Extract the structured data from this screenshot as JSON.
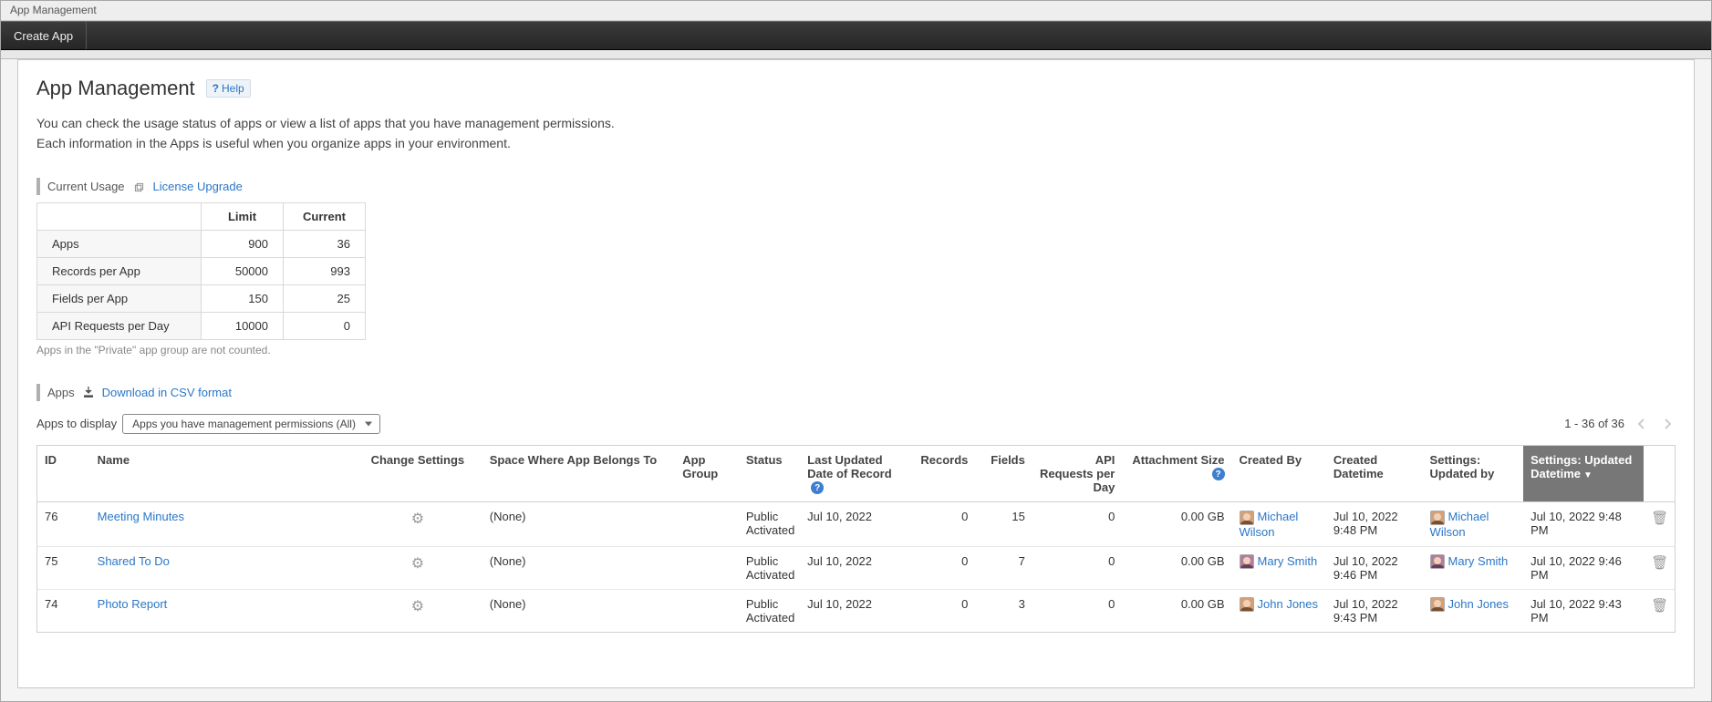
{
  "titlebar": "App Management",
  "toolbar": {
    "create_label": "Create App"
  },
  "heading": "App Management",
  "help_label": "Help",
  "description_l1": "You can check the usage status of apps or view a list of apps that you have management permissions.",
  "description_l2": "Each information in the Apps is useful when you organize apps in your environment.",
  "section_usage": {
    "title": "Current Usage",
    "upgrade_label": "License Upgrade"
  },
  "usage_table": {
    "col_limit": "Limit",
    "col_current": "Current",
    "rows": [
      {
        "label": "Apps",
        "limit": "900",
        "current": "36"
      },
      {
        "label": "Records per App",
        "limit": "50000",
        "current": "993"
      },
      {
        "label": "Fields per App",
        "limit": "150",
        "current": "25"
      },
      {
        "label": "API Requests per Day",
        "limit": "10000",
        "current": "0"
      }
    ],
    "footnote": "Apps in the \"Private\" app group are not counted."
  },
  "section_apps": {
    "title": "Apps",
    "download_label": "Download in CSV format"
  },
  "filter": {
    "label": "Apps to display",
    "selected": "Apps you have management permissions (All)"
  },
  "pagination": {
    "range_text": "1 - 36 of 36"
  },
  "columns": {
    "id": "ID",
    "name": "Name",
    "change": "Change Settings",
    "space": "Space Where App Belongs To",
    "group": "App Group",
    "status": "Status",
    "last_updated": "Last Updated Date of Record",
    "records": "Records",
    "fields": "Fields",
    "api": "API Requests per Day",
    "attachment": "Attachment Size",
    "created_by": "Created By",
    "created_dt": "Created Datetime",
    "updated_by": "Settings: Updated by",
    "updated_dt": "Settings: Updated Datetime"
  },
  "rows": [
    {
      "id": "76",
      "name": "Meeting Minutes",
      "space": "(None)",
      "group": "",
      "status": "Public",
      "activated": "Activated",
      "last_updated": "Jul 10, 2022",
      "records": "0",
      "fields": "15",
      "api": "0",
      "attachment": "0.00 GB",
      "created_by": "Michael Wilson",
      "created_dt": "Jul 10, 2022 9:48 PM",
      "updated_by": "Michael Wilson",
      "updated_dt": "Jul 10, 2022 9:48 PM",
      "avatar_cls": ""
    },
    {
      "id": "75",
      "name": "Shared To Do",
      "space": "(None)",
      "group": "",
      "status": "Public",
      "activated": "Activated",
      "last_updated": "Jul 10, 2022",
      "records": "0",
      "fields": "7",
      "api": "0",
      "attachment": "0.00 GB",
      "created_by": "Mary Smith",
      "created_dt": "Jul 10, 2022 9:46 PM",
      "updated_by": "Mary Smith",
      "updated_dt": "Jul 10, 2022 9:46 PM",
      "avatar_cls": "f"
    },
    {
      "id": "74",
      "name": "Photo Report",
      "space": "(None)",
      "group": "",
      "status": "Public",
      "activated": "Activated",
      "last_updated": "Jul 10, 2022",
      "records": "0",
      "fields": "3",
      "api": "0",
      "attachment": "0.00 GB",
      "created_by": "John Jones",
      "created_dt": "Jul 10, 2022 9:43 PM",
      "updated_by": "John Jones",
      "updated_dt": "Jul 10, 2022 9:43 PM",
      "avatar_cls": ""
    }
  ]
}
